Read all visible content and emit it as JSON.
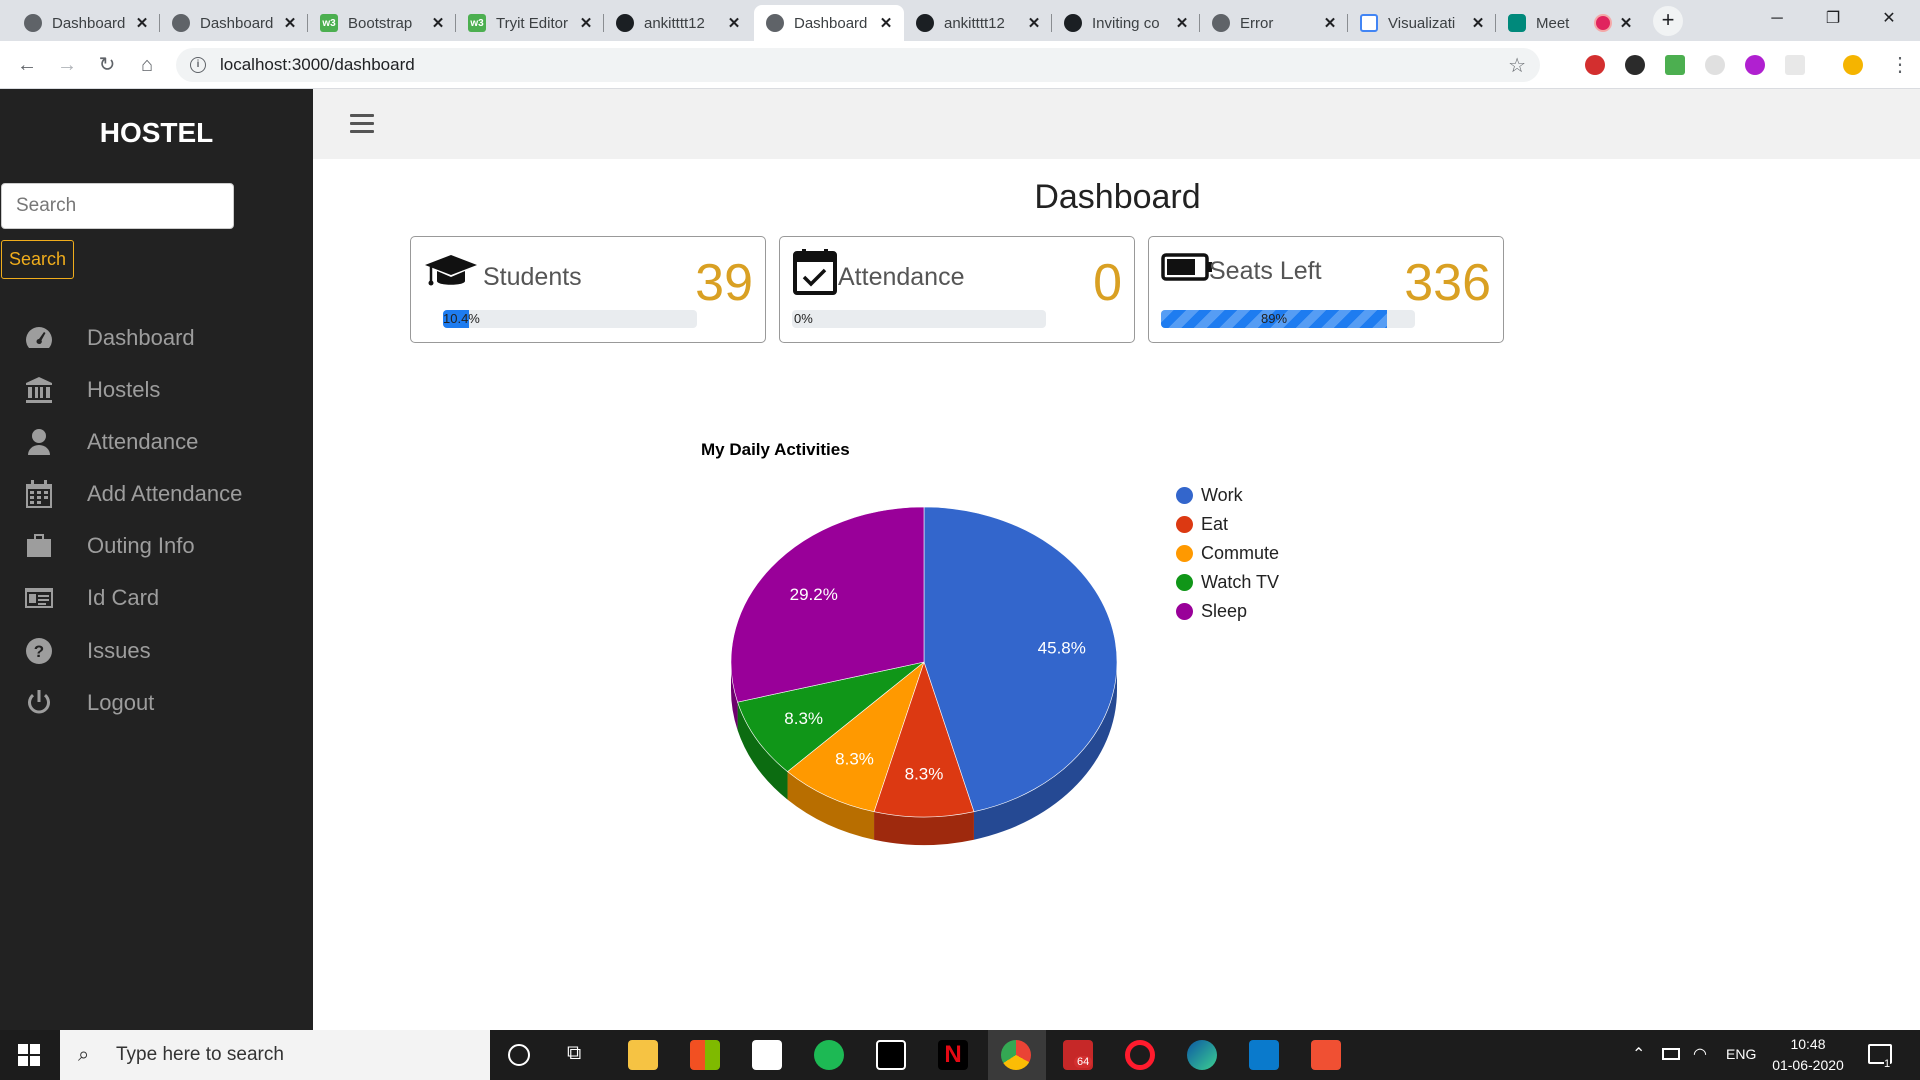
{
  "browser": {
    "tabs": [
      {
        "label": "Dashboard",
        "favicon": "globe-icon"
      },
      {
        "label": "Dashboard",
        "favicon": "globe-icon"
      },
      {
        "label": "Bootstrap",
        "favicon": "w3schools-icon"
      },
      {
        "label": "Tryit Editor",
        "favicon": "w3schools-icon"
      },
      {
        "label": "ankitttt12",
        "favicon": "github-icon"
      },
      {
        "label": "Dashboard",
        "favicon": "globe-icon",
        "active": true
      },
      {
        "label": "ankitttt12",
        "favicon": "github-icon"
      },
      {
        "label": "Inviting co",
        "favicon": "github-icon"
      },
      {
        "label": "Error",
        "favicon": "globe-icon"
      },
      {
        "label": "Visualizati",
        "favicon": "visualization-icon"
      },
      {
        "label": "Meet",
        "favicon": "meet-icon",
        "recording": true
      }
    ],
    "url": "localhost:3000/dashboard"
  },
  "sidebar": {
    "brand": "HOSTEL",
    "search_placeholder": "Search",
    "search_button": "Search",
    "items": [
      {
        "label": "Dashboard",
        "icon": "dashboard-gauge-icon"
      },
      {
        "label": "Hostels",
        "icon": "bank-icon"
      },
      {
        "label": "Attendance",
        "icon": "user-icon"
      },
      {
        "label": "Add Attendance",
        "icon": "calendar-icon"
      },
      {
        "label": "Outing Info",
        "icon": "briefcase-icon"
      },
      {
        "label": "Id Card",
        "icon": "id-card-icon"
      },
      {
        "label": "Issues",
        "icon": "question-circle-icon"
      },
      {
        "label": "Logout",
        "icon": "power-icon"
      }
    ]
  },
  "main": {
    "title": "Dashboard",
    "cards": [
      {
        "label": "Students",
        "value": "39",
        "progress_text": "10.4%",
        "progress": 0.104,
        "icon": "graduation-cap-icon"
      },
      {
        "label": "Attendance",
        "value": "0",
        "progress_text": "0%",
        "progress": 0.0,
        "icon": "calendar-check-icon"
      },
      {
        "label": "Seats Left",
        "value": "336",
        "progress_text": "89%",
        "progress": 0.89,
        "icon": "battery-icon"
      }
    ]
  },
  "colors": {
    "sidebar_bg": "#222222",
    "accent_gold": "#d9a023",
    "progress_blue": "#1e7cf0"
  },
  "chart_data": {
    "type": "pie",
    "title": "My Daily Activities",
    "three_d": true,
    "legend_position": "right",
    "series": [
      {
        "name": "Work",
        "value": 11,
        "label": "45.8%",
        "color": "#3366cc"
      },
      {
        "name": "Eat",
        "value": 2,
        "label": "8.3%",
        "color": "#dc3912"
      },
      {
        "name": "Commute",
        "value": 2,
        "label": "8.3%",
        "color": "#ff9900"
      },
      {
        "name": "Watch TV",
        "value": 2,
        "label": "8.3%",
        "color": "#109618"
      },
      {
        "name": "Sleep",
        "value": 7,
        "label": "29.2%",
        "color": "#990099"
      }
    ]
  },
  "taskbar": {
    "search_placeholder": "Type here to search",
    "language": "ENG",
    "time": "10:48",
    "date": "01-06-2020",
    "badge_count": "64",
    "notification_count": "1"
  }
}
